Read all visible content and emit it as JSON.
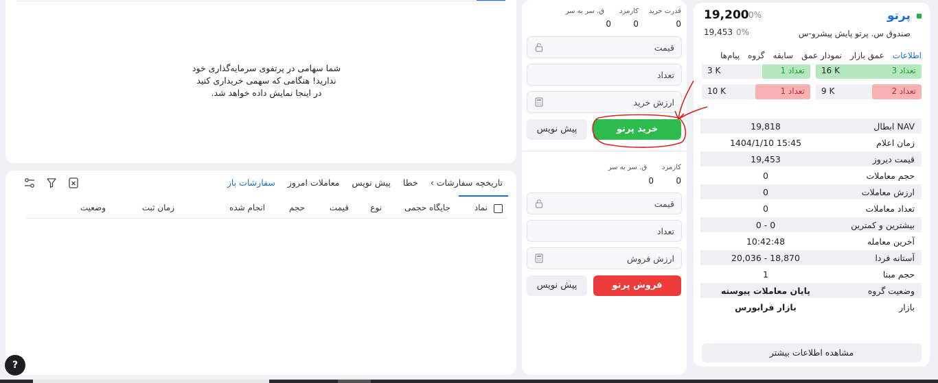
{
  "symbol": {
    "name": "پرتو",
    "full_name": "صندوق س. پرتو پایش پیشرو-س",
    "last_price": "19,200",
    "last_change_pct": "0%",
    "close_price": "19,453",
    "close_change_pct": "0%"
  },
  "info_tabs": [
    "اطلاعات",
    "عمق بازار",
    "نمودار عمق",
    "سابقه",
    "گروه",
    "پیام‌ها"
  ],
  "order_book": [
    {
      "buy_count": "تعداد 3",
      "buy_volume": "16 K",
      "sell_count": "تعداد 1",
      "sell_volume": "3 K"
    },
    {
      "buy_count": "تعداد 2",
      "buy_volume": "9 K",
      "sell_count": "تعداد 1",
      "sell_volume": "10 K"
    }
  ],
  "details": [
    {
      "label": "NAV ابطال",
      "value": "19,818"
    },
    {
      "label": "زمان اعلام",
      "value": "1404/1/10 15:45"
    },
    {
      "label": "قیمت دیروز",
      "value": "19,453"
    },
    {
      "label": "حجم معاملات",
      "value": "0"
    },
    {
      "label": "ارزش معاملات",
      "value": "0"
    },
    {
      "label": "تعداد معاملات",
      "value": "0"
    },
    {
      "label": "بیشترین و کمترین",
      "value": "0 - 0"
    },
    {
      "label": "آخرین معامله",
      "value": "10:42:48"
    },
    {
      "label": "آستانه فردا",
      "value": "20,036 - 18,870"
    },
    {
      "label": "حجم مبنا",
      "value": "1"
    },
    {
      "label": "وضعیت گروه",
      "value": "پایان معاملات پیوسته"
    },
    {
      "label": "بازار",
      "value": "بازار فرابورس"
    }
  ],
  "more_info_label": "مشاهده اطلاعات بیشتر",
  "buy_form": {
    "purchase_power_label": "قدرت خرید",
    "fee_label": "کارمزد",
    "breakeven_label": "ق. سر به سر",
    "purchase_power_value": "0",
    "fee_value": "0",
    "breakeven_value": "0",
    "price_placeholder": "قیمت",
    "quantity_placeholder": "تعداد",
    "value_placeholder": "ارزش خرید",
    "submit_label": "خرید پرتو",
    "draft_label": "پیش نویس"
  },
  "sell_form": {
    "fee_label": "کارمزد",
    "breakeven_label": "ق. سر به سر",
    "fee_value": "0",
    "breakeven_value": "0",
    "price_placeholder": "قیمت",
    "quantity_placeholder": "تعداد",
    "value_placeholder": "ارزش فروش",
    "submit_label": "فروش پرتو",
    "draft_label": "پیش نویس"
  },
  "portfolio": {
    "empty_line1": "شما سهامی در پرتفوی سرمایه‌گذاری خود",
    "empty_line2": "ندارید! هنگامی که سهمی خریداری کنید",
    "empty_line3": "در اینجا نمایش داده خواهد شد."
  },
  "order_tabs": [
    "سفارشات باز",
    "معاملات امروز",
    "پیش نویس",
    "خطا",
    "تاریخچه سفارشات"
  ],
  "order_tabs_chevron": "›",
  "order_columns": [
    "نماد",
    "جایگاه حجمی",
    "نوع",
    "قیمت",
    "حجم",
    "انجام شده",
    "زمان ثبت",
    "وضعیت"
  ],
  "help_label": "?",
  "colors": {
    "accent": "#1b6fd6",
    "buy": "#2dbb4e",
    "sell": "#ee3b3b",
    "annotation": "#e0201e"
  }
}
